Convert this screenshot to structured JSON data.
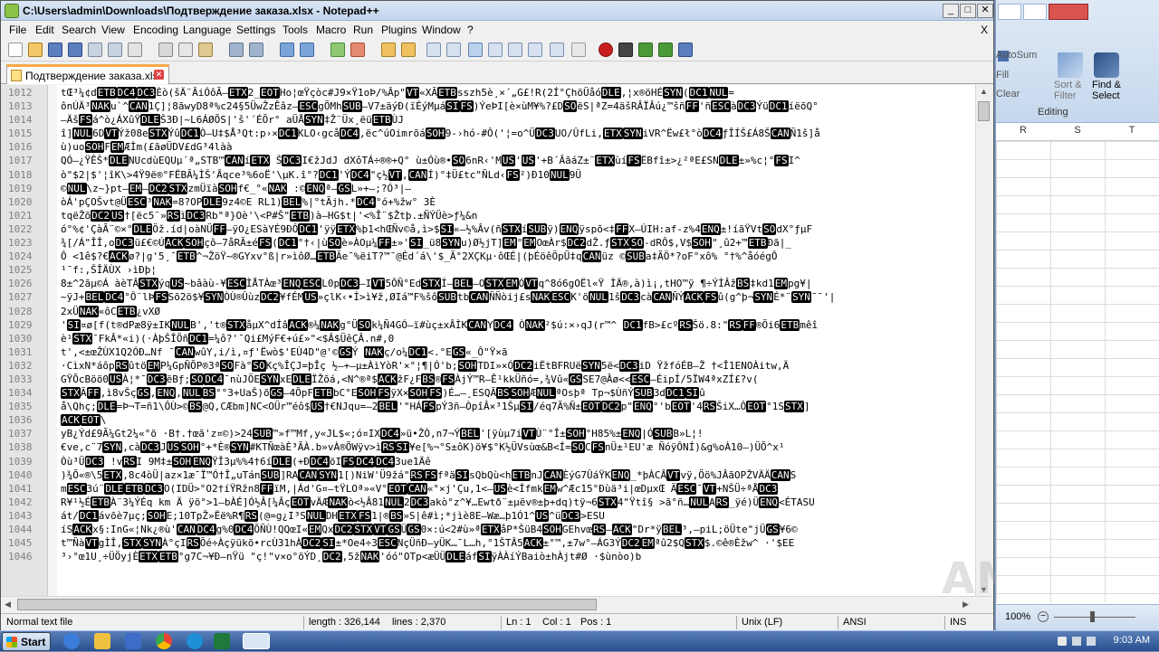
{
  "window": {
    "title": "C:\\Users\\admin\\Downloads\\Подтверждение заказа.xlsx - Notepad++",
    "minimize": "_",
    "maximize": "□",
    "close": "✕"
  },
  "menu": [
    "File",
    "Edit",
    "Search",
    "View",
    "Encoding",
    "Language",
    "Settings",
    "Tools",
    "Macro",
    "Run",
    "Plugins",
    "Window",
    "?"
  ],
  "menu_close": "X",
  "tab": {
    "label": "Подтверждение заказа.xlsx",
    "close": "✕"
  },
  "editor": {
    "lines": [
      {
        "n": "1012",
        "t": "tŒ³¼¢dETBDC4DC3Èò(šÄ¨ÂiÓôÃ–ETX2_EOTHo¦œŸçòc#J9×Ÿ1oÞ/%Âp\"VT«XÃETBsszh5è¸×´„G£!R(2Í°ÇhöÜåóDLE,¦x®öHÉSYN(DC1NUL="
      },
      {
        "n": "1013",
        "t": "ônÚÄ³NAKu`^CAN1Ç]¦8ãwyD8ª%c24§5ÜwŽzÊâz—ESCgÕMhSUB—V7±äýÐ(ïÉýMµáSIFS)ÝeÞI[è×ùM¥%?£DSOëS|ªZ=4äšRÂÏÂú¿™šñFF'ñESCàDC3ÝüDC1íëõQ°"
      },
      {
        "n": "1014",
        "t": "–ÄšFSá^ò¿ÁXûŸDLEŠ3Ð|~L6ÁØÕS|'š'´ÉÕr° aÜÅSYN‡Ž¨Üx¸ëüETBÙJ"
      },
      {
        "n": "1015",
        "t": "î]NUL6DVTÝž08eSTXÝûDC1Ò—U‡$Å³Qt:p›×DC1KLO‹gcåDC4,ëc^úOimrõáSOH9-›hó-#Ô('¦=o^ÜDC3UO/ÛfLi,ETXSYNiVR^Ëw£ł°òDC4ƒÎÍŠ£Á8ŠCANÑ1š]å"
      },
      {
        "n": "1016",
        "t": "ù)uoSOHFEMÆÌm(£ãøÜDV£dG³4làà"
      },
      {
        "n": "1017",
        "t": "QÓ—¿ŸÊŠ*DLENUcdùEQUµ´ª„STB™CANíETX ŠDC3I€žJdJ dXôTÁ÷®®+Q° ù±Óù®•SO6nR‹'MUS'US'+B´ÂãáZ±¨ETXùíFSËBfî±>¿²ªE£SNDLE±»%c¦°FSI^"
      },
      {
        "n": "1018",
        "t": "ò\"$2|$'¦îK\\>4Ÿ9ë®°FËBÃ¼ÌŠ'Âqce³%6oË'\\µK.î°?DC1'ÝDC4\"ç½VT,CANÍ)°‡Ü£tc\"ÑLd‹FS²)Ð10NUL9Ü"
      },
      {
        "n": "1019",
        "t": "©NUL\\z~}pt—EM—DC2STXzmÜïàSOHf€_°«NAK :©ENQª—GSL»+—;?Ó³|—"
      },
      {
        "n": "1020",
        "t": "òÁ'pÇOŠvt@ÜESC³NAK=8?OPDLE9z4©E RL1)BEL%|°tÃjh.*DC4°ó+%žw° 3È"
      },
      {
        "n": "1021",
        "t": "tqëŽõDC2US†[ëc5¨»RSìDC3Rb\"ª}Oè'\\<P#Š\"ETB)à—HG$t|'<%Î¨$Žtþ.±ÑÝÜè>ƒ¼&n"
      },
      {
        "n": "1022",
        "t": "ó°%¢'ÇàÃ¨©×°DLEÖž.íd|oàNÜFF—ÿO¿ESàYÉ9ÐÔDC1'ÿÿETX%þ1<hŒÑv©å,ì>$SI«—½%Âv(ñSTXíSUBÿ)ENQÿspõ<‡FFX—ÚIH:af-z%4ENQ±!íãŸVtSOdX°ƒµF"
      },
      {
        "n": "1023",
        "t": "¾[/Á\"ÎÎ,oDC3ü£€©ÚACKSOHçô—7åRÃ±éFS(DC1°†‹|ùSOè»ÀOµ¼FF±»'SI_ü8SYNu)Ø½jT]EM°EMOœÀr$DC2dŽ.ƒSTXSO-dRÔ$,V$SOH\"¸û2+™ETBÐã|_"
      },
      {
        "n": "1024",
        "t": "Ô   <1ê$?€ACKø?|g'5¸¯ETB^¬ŽöŸ~®GYxv°ß|r»ìôØ…ETBÃe¯%ëiT?™¯@Éd´á\\'$_Ã°2XÇKµ·ôŒÉ|(þÉöêÖpÜ‡qCANüz    ©SUBa‡ÃÖ*?oF°xô% °†%^åóégÔ"
      },
      {
        "n": "1025",
        "t": "¹¯f:,ŠÎÄÙX ›ìÐþ¦"
      },
      {
        "n": "1026",
        "t": "8±^2ãµ©Á    àèTÂSTXýqUS~bâàù-¥ESCÌÅTÀœ³ENQESCL0pDC3—IVT5ÔÑ°EdSTXÍ—BEL—OSTXEMÓVTq^8ó6gOËl«Ÿ ÌÄ®,à)ì¡,tHO™ÿ   ¶÷ÝÌÂžBS‡kd1EMpg¥|"
      },
      {
        "n": "1027",
        "t": "~ÿJ+BELDC4°Ô¨lÞFSSõ2ö$¥SYNÒÙ®ÛùzDC2¥fÉMUS»çlK‹•Í>ì¥ž,ØIá™F%šôSUBtbCANÑÑòij£sNAKESCK'öNUL1šDC3càCANÑÝACKFSû(g^þ¬SYNÉ*¨SYN¯¯'|"
      },
      {
        "n": "1028",
        "t": "2xÜNAK«ôCETB¿vXØ"
      },
      {
        "n": "1029",
        "t": "'SI¤ø[f(t®dPæ8ÿ±IKNULB','t®STXåµX^dÍâACK®¼NAKg°ÜSOk¼Ñ4GÓ—ï#ùç±xÂÌKCANYDC4 ÒNAK²$ú:×›qJ(r™^ DC1fB>£cºRSŠö.8:\"RSFF®Öi6ETBmêî"
      },
      {
        "n": "1030",
        "t": "è¹STX¯FkÂ*«i)(·ÀþŠÎÕñDC1=¼ô?'¯Qi£MýF€+ú£»\"<$Â$ÜêÇÂ.n#,0"
      },
      {
        "n": "1031",
        "t": "t',<±œŽÙX1Q2ÓÐ…Nf ¯CANwûY,i/ì,¤ƒ'Ëwò$'EÙ4D\"@'©GSÝ NAKç/o¼DC1<.°EGS«_Ô\"Ÿ×ã"
      },
      {
        "n": "1032",
        "t": "·CìxN*áôpRSûtöEMP¼GpÑÕP®3ªSOFà°SOKç%ÎÇJ=þÎç ½—+—µ±ÀìYòR'×°¦¶|Ó'b;SOHTDI»×ÓDC2iËtBFRUëSYN5ë<DC3iD ŸžfóÉB—Ž †<Î1ENOÀitw,Ä"
      },
      {
        "n": "1033",
        "t": "GŸÕcBöö0USÀ¦*¯DC3ëBƒ;SODC4¯nùJÖESYNxEDLEÏŽõá,<N^®ª$ACKžF¿FBS®FSÀjÝ™R—Ê¹kkÜñó=,¾Vû«GSSE7@Âø<<ESC—ÉipÍ/5ÏW4ªxZÍ£?v("
      },
      {
        "n": "1034",
        "t": "STXÃFF,ì8vŠçGS,ENQ,NULBS°°3+UaŠ)õGS—4ÕpFETBbC°ESOHFSÿX×SOHFS)É…—¸ESQÃBSSOHÆNULªOsþª Tp¬$ÙñÝSUB3dDC1SIû"
      },
      {
        "n": "1035",
        "t": "å\\Qhç;DLE=Þ¬T=ñ1\\ÔÙ>©BS@Q,CÆbm]NC<OÜr™éô$US†€NJqu=—2BEL'\"HÁFSpÝ3ñ—ÒpîÂ×³1ŠµSI/éq7Ã%Ñ±EOTDC2p\"ENQ°'bEOT'4RSŠiX…ÔEOT°1SSTX]"
      },
      {
        "n": "1036",
        "t": "ACKEOT\\"
      },
      {
        "n": "1037",
        "t": "yB¿Ýd£9Ã¼Gt2¼«°ö ·B†.†œã'z¤©)>24SUB™»f™Mf,y«JL$«;ó¤IXDC4»ü•ŽÒ,n7¬ÝBEL'[ÿùµ7iVTÙ¨°Î±SOH°H85%±ENQ|ÓSUBB»L¦!"
      },
      {
        "n": "1038",
        "t": "€ve,c¨7SYN,càDC3JUSSOH°+*È®SYN#KTÑœàÈ³ÃÀ.b»vÀ®ÕWÿv>ìRSSI¥e[%¬°S±ôK)ö¥$°K½ÜVsùœ&B<Í=SOCFSnÜ±¹EU'æ     ÑóÿÔNÍ)&g%oÀ10—)ÜÕ^x¹"
      },
      {
        "n": "1039",
        "t": "Òù³ÜDC3 !vRSI 9M‡±SOHENQŸÎ3µ%%4†6íDLE(+ÐDC4öIFSDC4DC43ue1Äê"
      },
      {
        "n": "1040",
        "t": ")¾Õ«®\\5ETX,8c4òÜ|az×1æ¯Ï™Ó†Î„uTánSUB]RACANSYN1[)NiW'Ü9žá\"RSFSfªäSIsQbQù<hETBnJCANÈýG7ÛáŸKENQ_*þÀCÂVTvÿ,Öö%JÂãOPŽVÄÄCANS"
      },
      {
        "n": "1041",
        "t": "mESC3ú¨DLEETBDC3O(IDÜ>°O2†íŸRžn8FFïM,|Ád'G¤—tŸLOª»«V°EOTCAN«°×j'Çu,1<—USè<ÍfmkEMw^Æc15°Ðùä³i|œDµxŒ  ÃESC¯VT+NŠÜ÷ªÅDC3"
      },
      {
        "n": "1042",
        "t": "R¥¹½ÉETBÀ¨3¼ÝÉq km   Ä ÿö°>1—bÀÉ]Ó½Â[¼ÂçEOTvÄÆNAKò<½Â81NUL2DC3akò°z^¥…Ewtð¨±µëv®±þ+dq)tÿ¬6STX4\"Ÿtî§ >ã°ñ…NULARS_ÿé)ÜENQ<ÉTASU"
      },
      {
        "n": "1043",
        "t": "át/DC1ávõè7µç;SOHE;10TpŽ»Ëë%R¶RS(@=g¿I³SNULDHETXFS1|®BS»S|ê#ì;*jìè8E—Wæ…þ1Ó1^US^üDC3>ESU"
      },
      {
        "n": "1044",
        "t": "íSACKx§:InG«¦Nk¿®ù'CANDC4g%0DC4ÕÑÙ!QQœI«EMQxDC2STXVTGSÜGS0×:ú<2#ù»ªETXåP*ŠüB4SOHGEhvœRS—ACK\"Dr*ÿBEL³,–piL;öÜte\"jÜGS¥6©"
      },
      {
        "n": "1045",
        "t": "t™ÑàVTgÌÎ,STXSYNÀ°çIRSÕé÷Àçÿükõ•rcÙ31hÀDC2SI±*Oe4÷3ESCNçÜñÐ—yÜK…¯L…h,°1ŠTÂ5ACK±°™,±7w°—ÁG3ÝDC2EMªû2$QSTX$.©ê®Èžw^ ·'$EE"
      },
      {
        "n": "1046",
        "t": "³›°œ1U¸÷ÜÖyjÈETXETB°g7C¬¥Ð—nŸü    \"ç!\"v×o°öÝD¸DC2,5žNAK'óó\"OTp<æÜÜDLEáfSIÿÀÀíÝBaiò±hÀjt#Ø ·$ùnòo)b"
      }
    ]
  },
  "status": {
    "type": "Normal text file",
    "length": "length : 326,144",
    "lines": "lines : 2,370",
    "ln": "Ln : 1",
    "col": "Col : 1",
    "pos": "Pos : 1",
    "eol": "Unix (LF)",
    "encoding": "ANSI",
    "mode": "INS"
  },
  "excel": {
    "autosum": "AutoSum",
    "fill": "Fill",
    "clear": "Clear",
    "sort_filter_1": "Sort &",
    "sort_filter_2": "Filter",
    "find_select_1": "Find &",
    "find_select_2": "Select",
    "group": "Editing",
    "columns": [
      "R",
      "S",
      "T"
    ],
    "zoom": "100%"
  },
  "taskbar": {
    "start": "Start",
    "clock": "9:03 AM"
  },
  "watermark": "ANY.RUN"
}
